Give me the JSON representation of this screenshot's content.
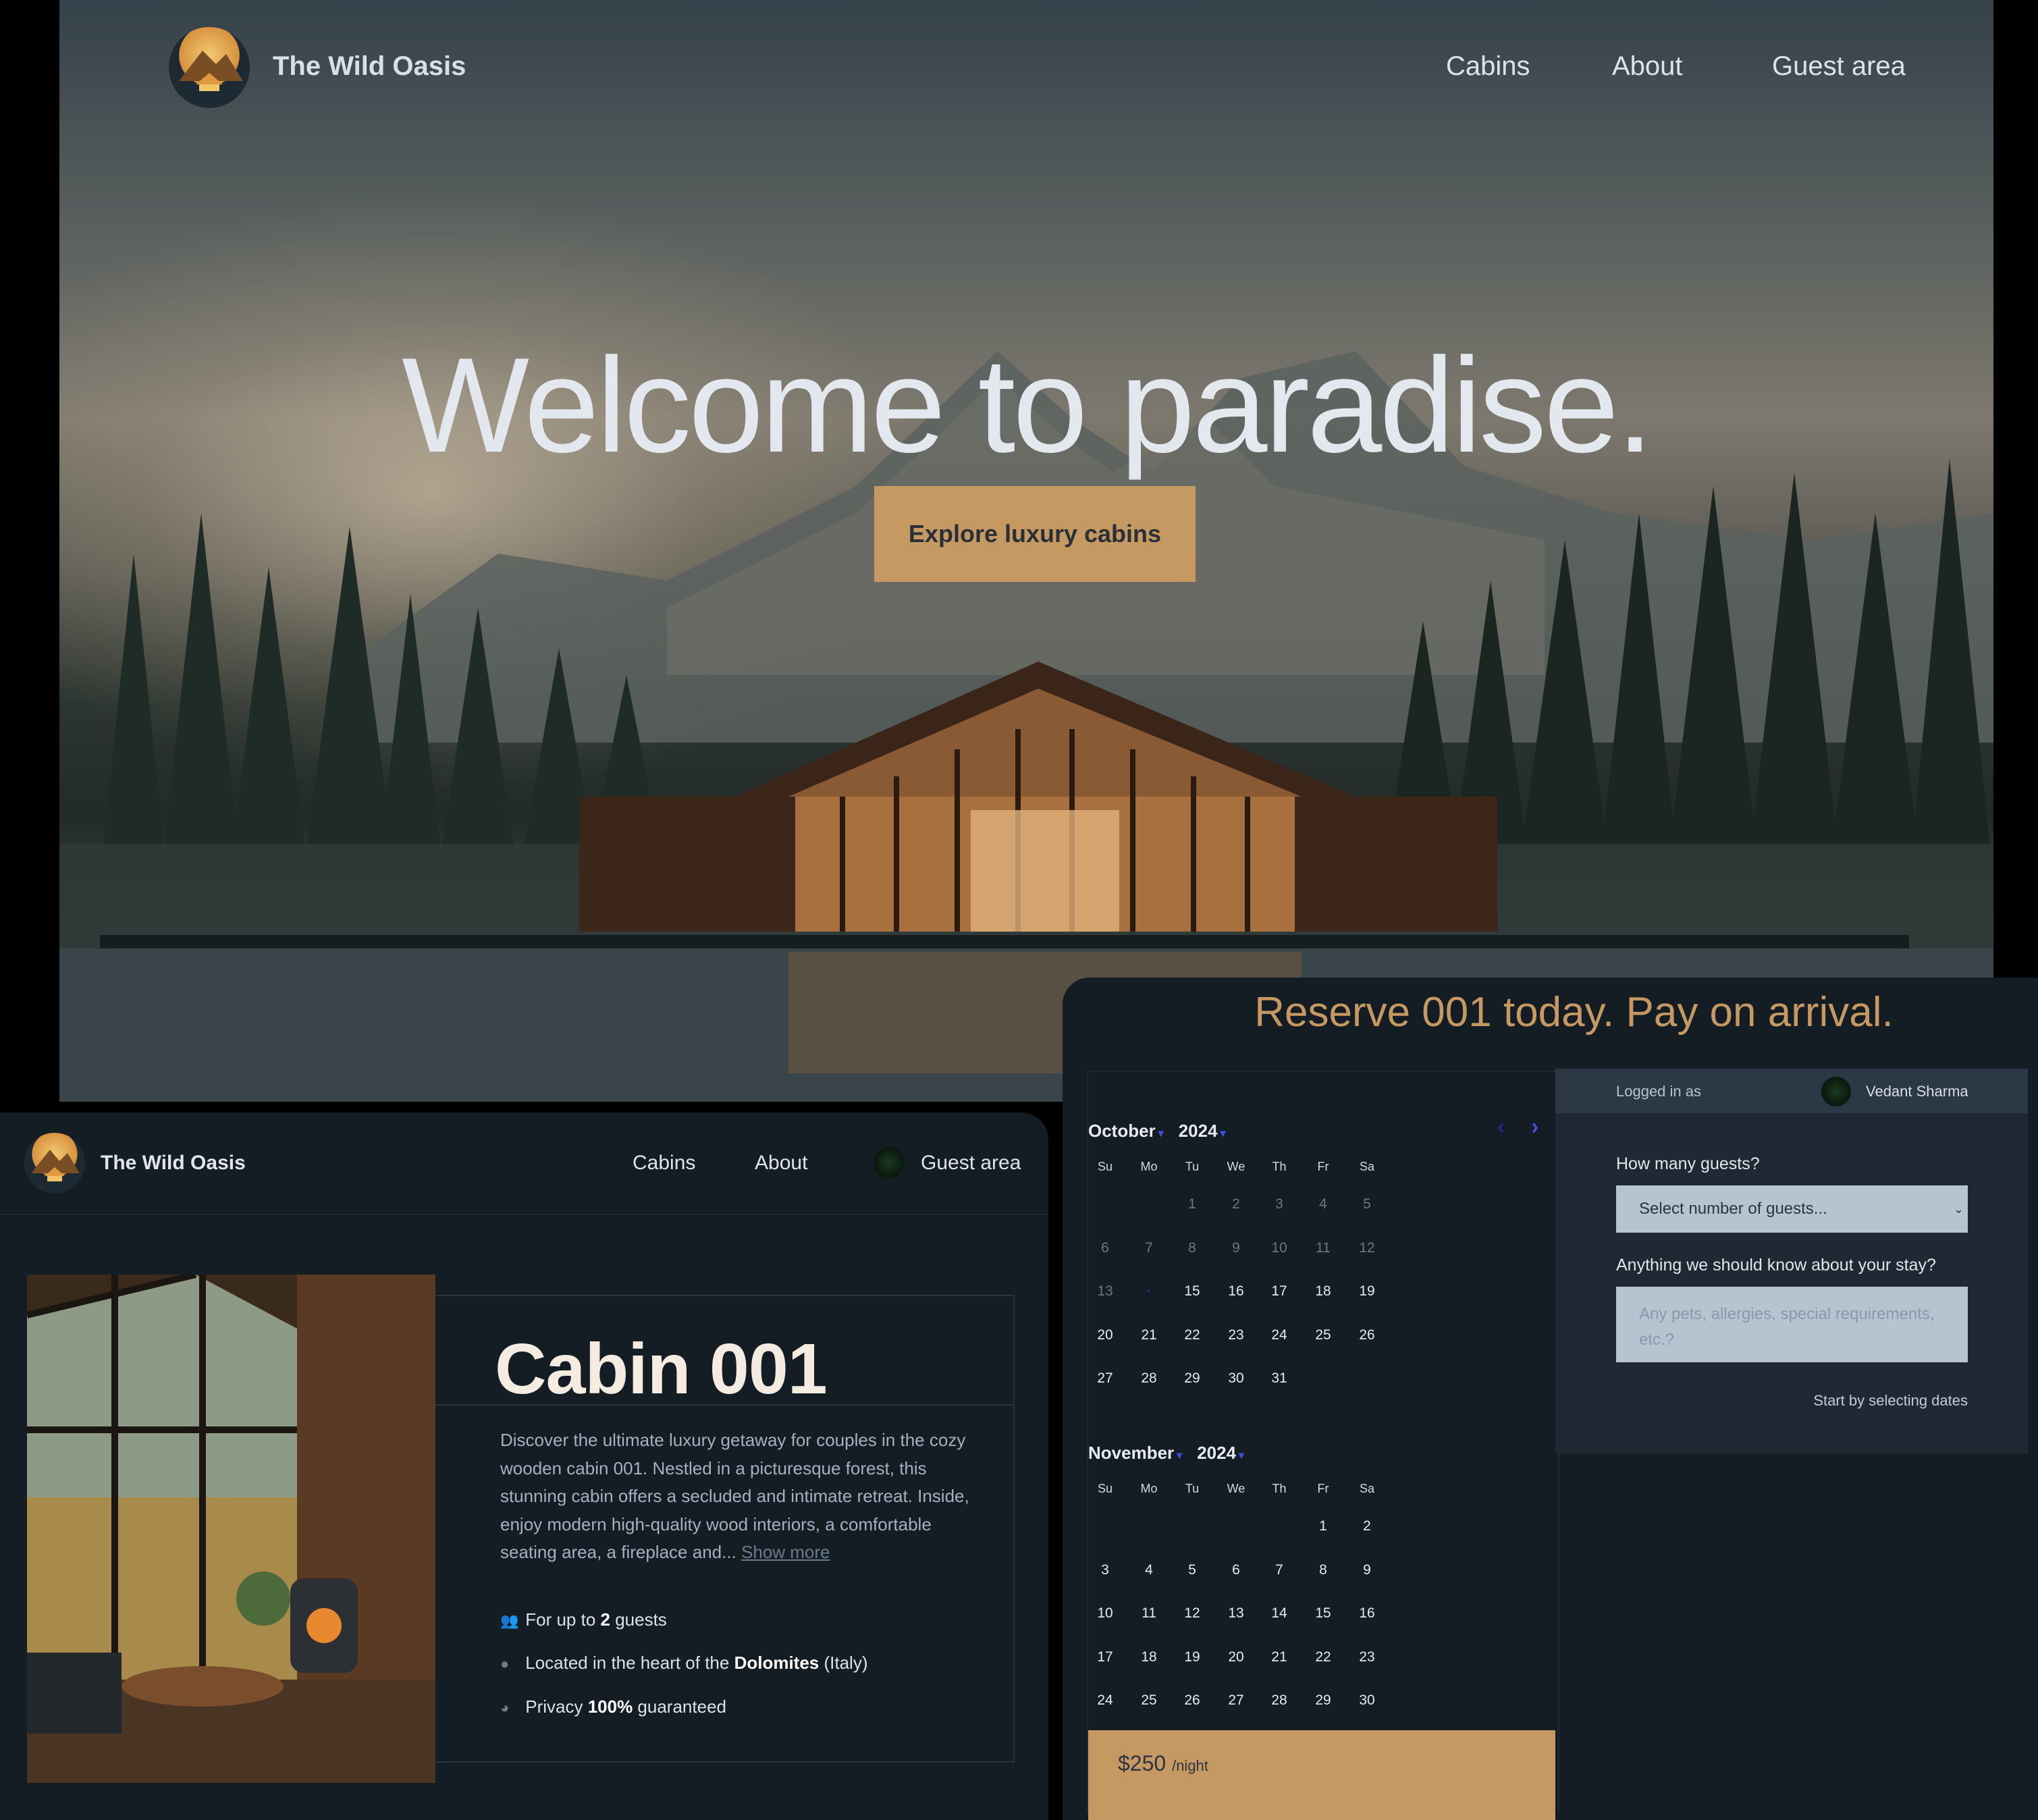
{
  "hero": {
    "brand": "The Wild Oasis",
    "nav": [
      "Cabins",
      "About",
      "Guest area"
    ],
    "title": "Welcome to paradise.",
    "cta": "Explore luxury cabins"
  },
  "cabin_page": {
    "brand": "The Wild Oasis",
    "nav": [
      "Cabins",
      "About",
      "Guest area"
    ],
    "title": "Cabin 001",
    "description": "Discover the ultimate luxury getaway for couples in the cozy wooden cabin 001. Nestled in a picturesque forest, this stunning cabin offers a secluded and intimate retreat. Inside, enjoy modern high-quality wood interiors, a comfortable seating area, a fireplace and...",
    "show_more": "Show more",
    "features": [
      {
        "icon": "users-icon",
        "pre": "For up to ",
        "bold": "2",
        "post": " guests"
      },
      {
        "icon": "map-pin-icon",
        "pre": "Located in the heart of the ",
        "bold": "Dolomites",
        "post": " (Italy)"
      },
      {
        "icon": "eye-slash-icon",
        "pre": "Privacy ",
        "bold": "100%",
        "post": " guaranteed"
      }
    ]
  },
  "reservation": {
    "title": "Reserve 001 today. Pay on arrival.",
    "weekdays": [
      "Su",
      "Mo",
      "Tu",
      "We",
      "Th",
      "Fr",
      "Sa"
    ],
    "months": [
      {
        "month": "October",
        "year": "2024",
        "first_weekday": 2,
        "days": 31,
        "past_through": 14
      },
      {
        "month": "November",
        "year": "2024",
        "first_weekday": 5,
        "days": 30,
        "past_through": 0
      }
    ],
    "price": "$250",
    "per_night": "/night",
    "logged_in_label": "Logged in as",
    "user_name": "Vedant Sharma",
    "guests_label": "How many guests?",
    "guests_placeholder": "Select number of guests...",
    "notes_label": "Anything we should know about your stay?",
    "notes_placeholder": "Any pets, allergies, special requirements, etc.?",
    "hint": "Start by selecting dates"
  },
  "colors": {
    "accent": "#c69963",
    "bg": "#141c24",
    "nav_blue": "#3d4fd4"
  }
}
